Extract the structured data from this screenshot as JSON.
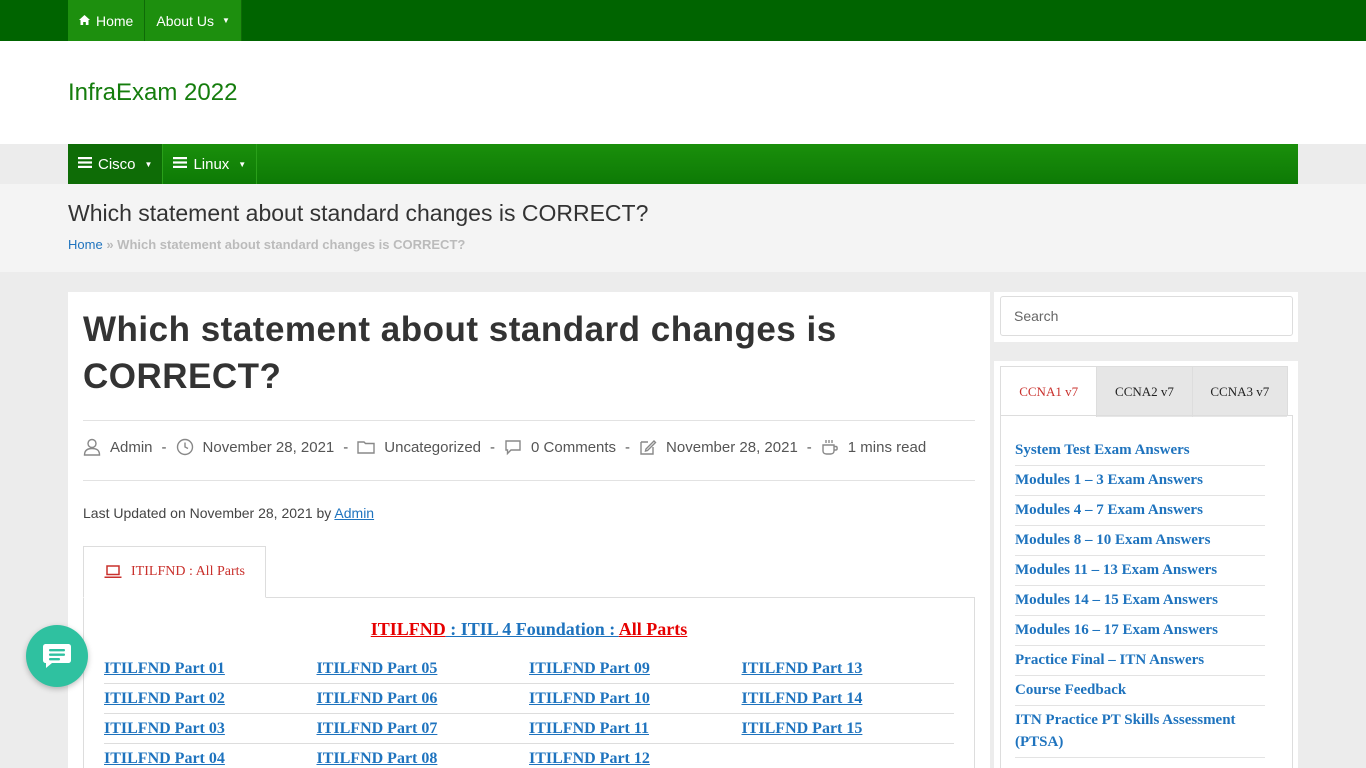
{
  "topnav": {
    "home": "Home",
    "about": "About Us"
  },
  "site": {
    "title": "InfraExam 2022"
  },
  "mainnav": {
    "items": [
      "Cisco",
      "Linux"
    ]
  },
  "page": {
    "heading": "Which statement about standard changes is CORRECT?",
    "breadcrumb_home": "Home",
    "breadcrumb_sep": "»",
    "breadcrumb_current": "Which statement about standard changes is CORRECT?"
  },
  "post": {
    "title": "Which statement about standard changes is CORRECT?",
    "meta": {
      "author": "Admin",
      "date": "November 28, 2021",
      "category": "Uncategorized",
      "comments": "0 Comments",
      "updated": "November 28, 2021",
      "read": "1 mins read",
      "sep": "-"
    },
    "last_updated_prefix": "Last Updated on November 28, 2021 by",
    "last_updated_author": "Admin",
    "tab_label": "ITILFND : All Parts",
    "parts_heading": {
      "a": "ITILFND",
      "b": " : ITIL 4 Foundation : ",
      "c": "All Parts"
    },
    "parts": [
      [
        "ITILFND Part 01",
        "ITILFND Part 05",
        "ITILFND Part 09",
        "ITILFND Part 13"
      ],
      [
        "ITILFND Part 02",
        "ITILFND Part 06",
        "ITILFND Part 10",
        "ITILFND Part 14"
      ],
      [
        "ITILFND Part 03",
        "ITILFND Part 07",
        "ITILFND Part 11",
        "ITILFND Part 15"
      ],
      [
        "ITILFND Part 04",
        "ITILFND Part 08",
        "ITILFND Part 12",
        ""
      ]
    ]
  },
  "sidebar": {
    "search_placeholder": "Search",
    "tabs": [
      "CCNA1 v7",
      "CCNA2 v7",
      "CCNA3 v7"
    ],
    "links": [
      "System Test Exam Answers",
      "Modules 1 – 3 Exam Answers",
      "Modules 4 – 7 Exam Answers",
      "Modules 8 – 10 Exam Answers",
      "Modules 11 – 13 Exam Answers",
      "Modules 14 – 15 Exam Answers",
      "Modules 16 – 17 Exam Answers",
      "Practice Final – ITN Answers",
      "Course Feedback",
      "ITN Practice PT Skills Assessment (PTSA)"
    ]
  },
  "colors": {
    "topbar": "#006400",
    "nav_green": "#1a8f0b",
    "link_blue": "#1e73be",
    "accent_red": "#c9302c",
    "chat_teal": "#2fc1a0"
  },
  "icons": {
    "home": "home-icon",
    "menu": "menu-icon",
    "user": "user-icon",
    "clock": "clock-icon",
    "folder": "folder-icon",
    "comment": "comment-icon",
    "edit": "edit-icon",
    "coffee": "coffee-icon",
    "laptop": "laptop-icon",
    "chat": "chat-icon"
  }
}
